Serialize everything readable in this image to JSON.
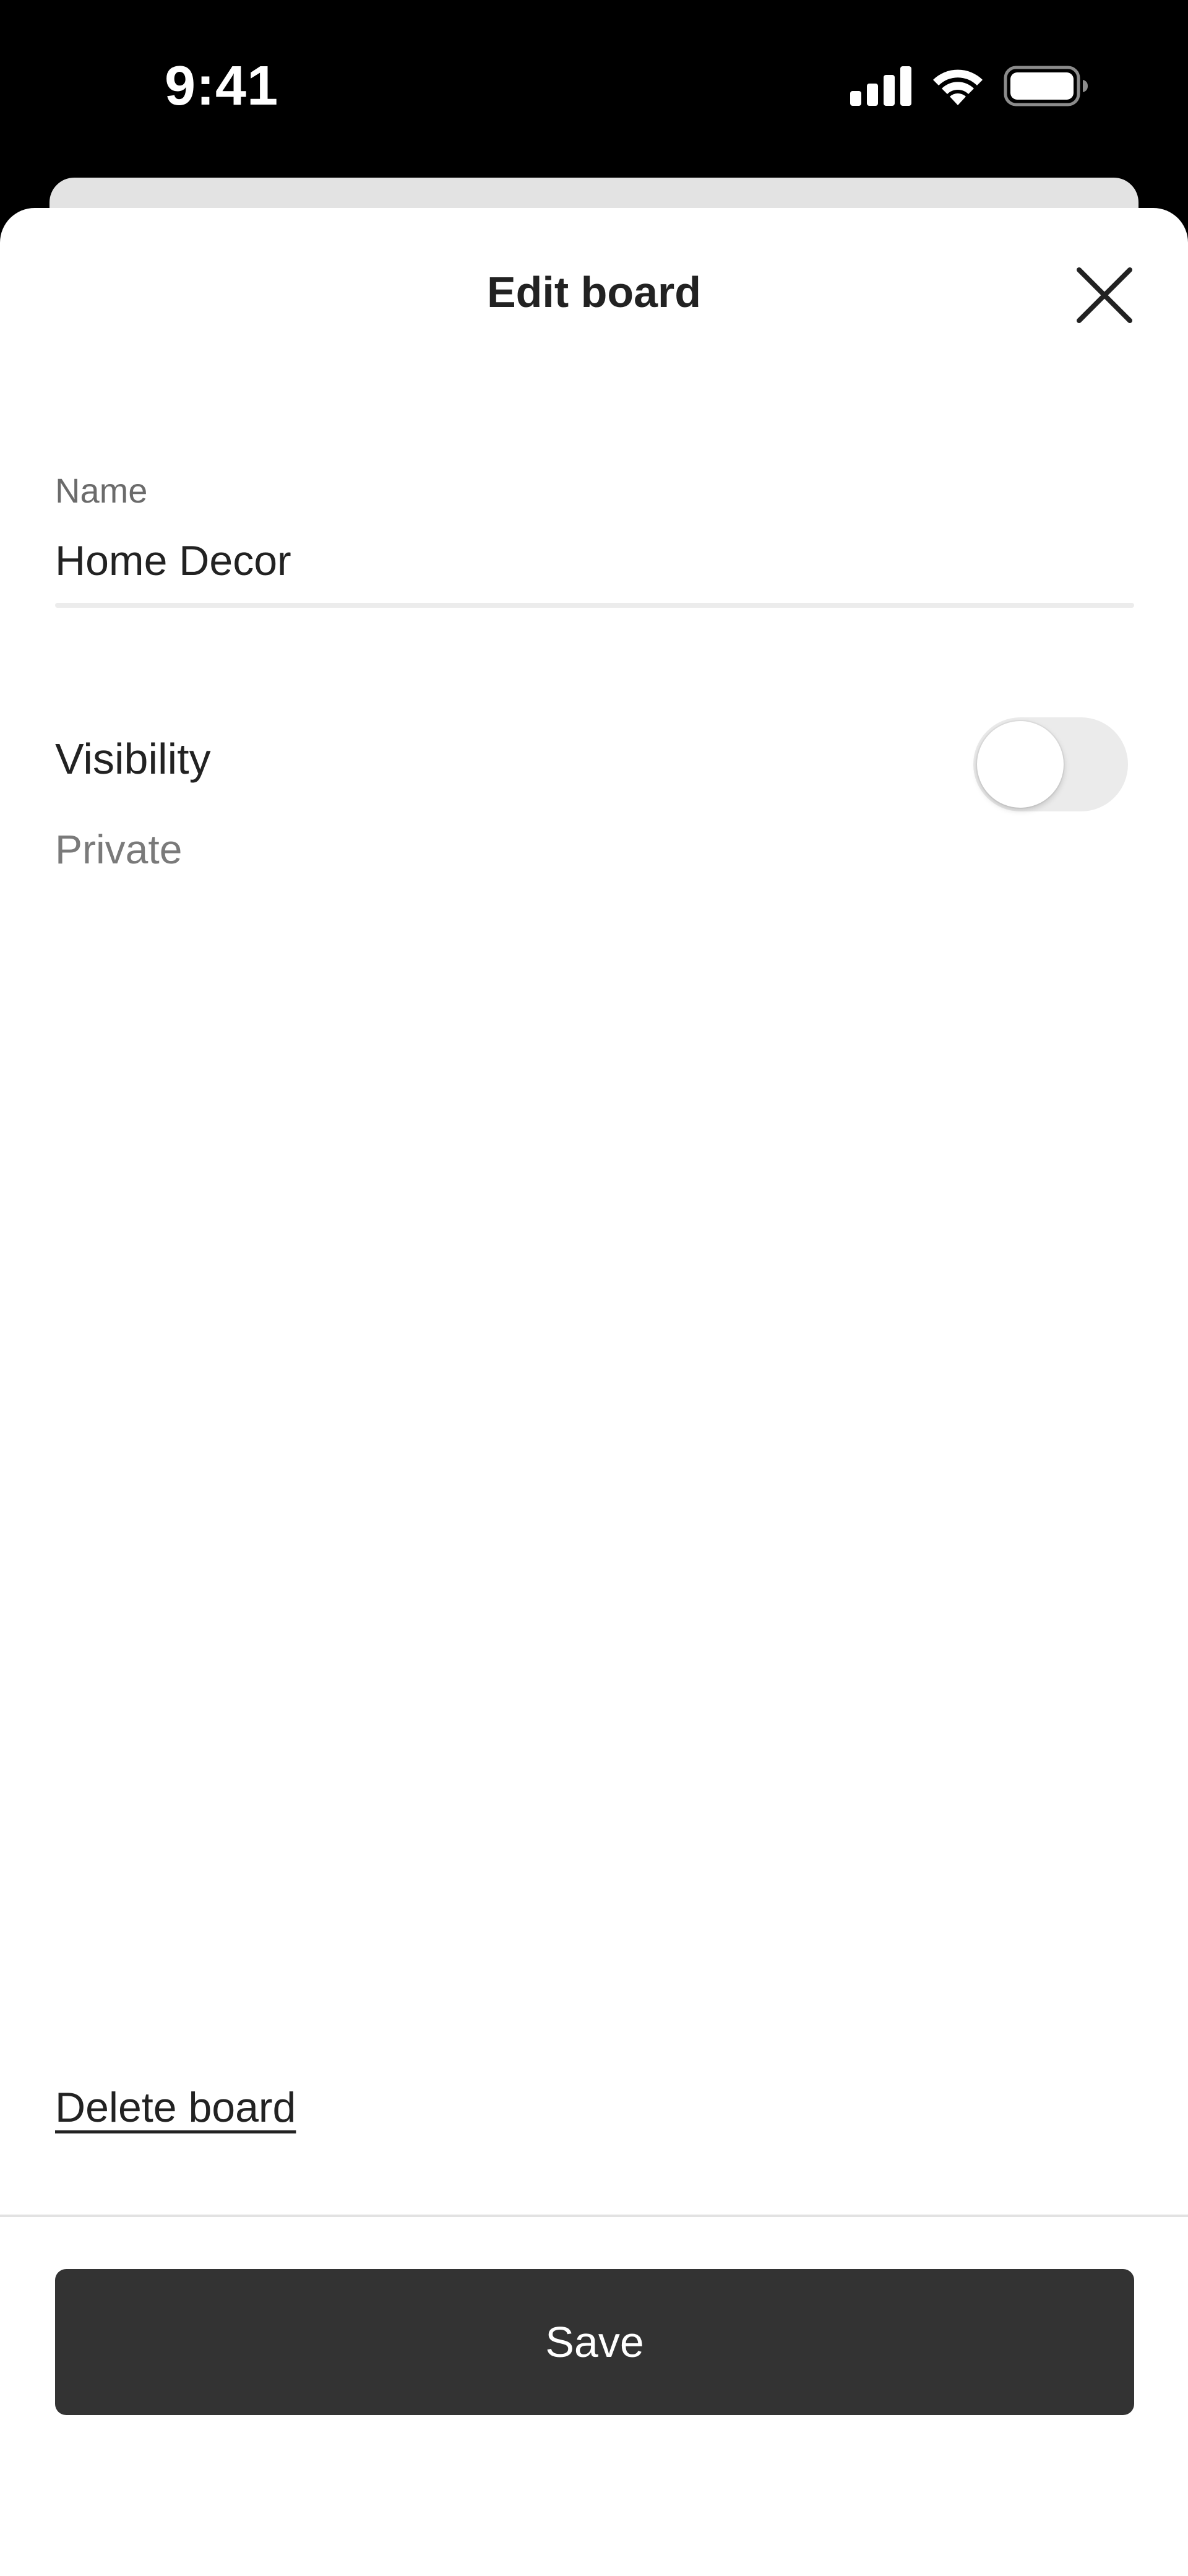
{
  "status_bar": {
    "time": "9:41",
    "icons": [
      "cellular-signal-icon",
      "wifi-icon",
      "battery-icon"
    ]
  },
  "sheet": {
    "title": "Edit board",
    "close_icon": "close-icon"
  },
  "name_field": {
    "label": "Name",
    "value": "Home Decor"
  },
  "visibility": {
    "label": "Visibility",
    "value": "Private",
    "toggle_on": false
  },
  "actions": {
    "delete_label": "Delete board",
    "save_label": "Save"
  },
  "colors": {
    "save_button": "#333333",
    "toggle_track": "#ebebeb",
    "secondary_text": "#7a7a7a"
  }
}
